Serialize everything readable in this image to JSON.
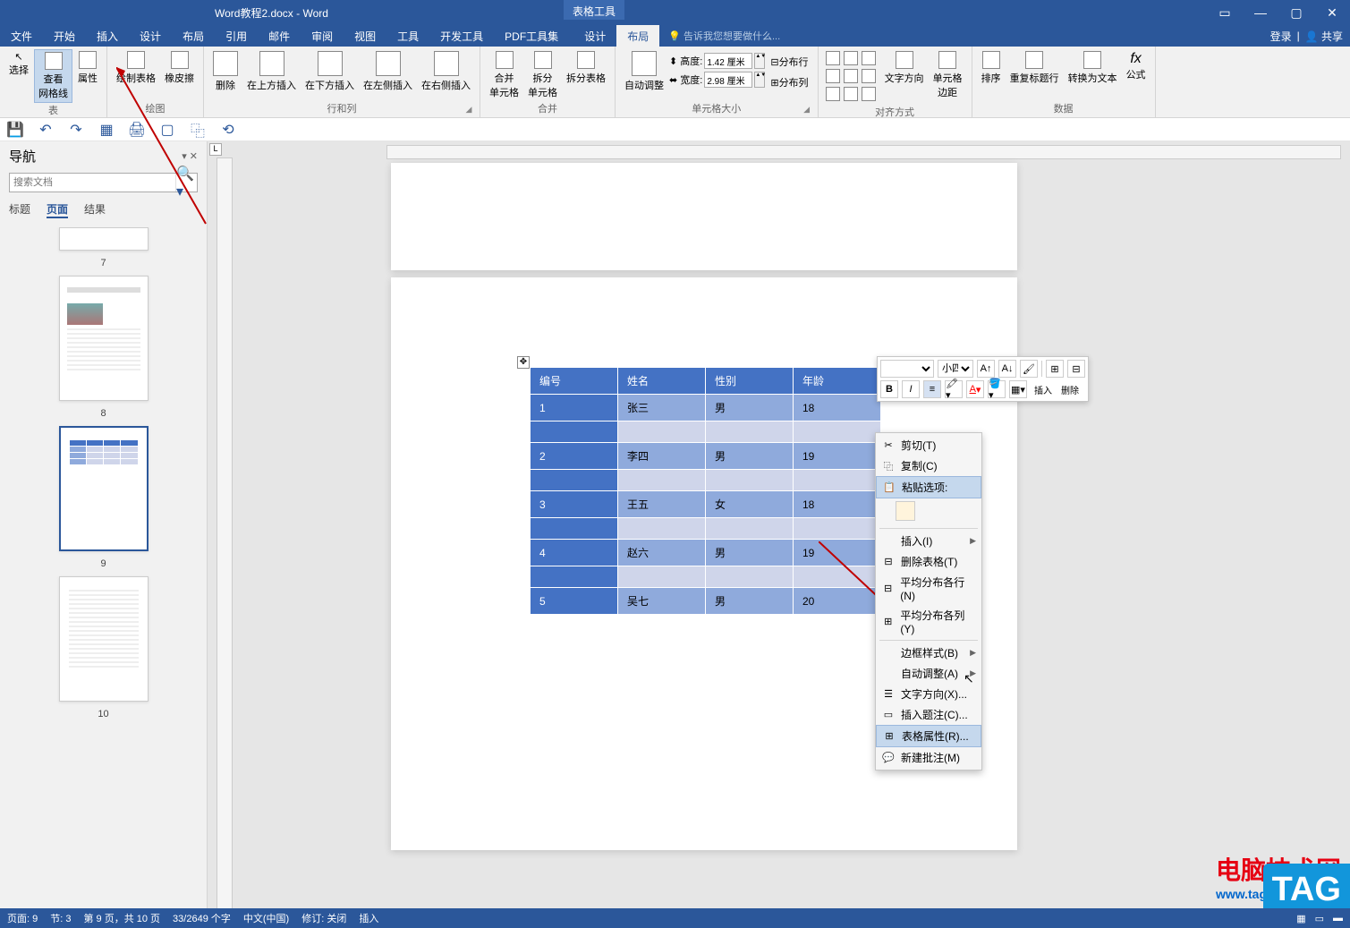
{
  "titlebar": {
    "filename": "Word教程2.docx - Word",
    "tabletools": "表格工具",
    "login": "登录",
    "share": "共享"
  },
  "menu": {
    "file": "文件",
    "home": "开始",
    "insert": "插入",
    "design": "设计",
    "layout": "布局",
    "references": "引用",
    "mailings": "邮件",
    "review": "审阅",
    "view": "视图",
    "tools": "工具",
    "developer": "开发工具",
    "pdftools": "PDF工具集",
    "tdesign": "设计",
    "tlayout": "布局",
    "tellme": "告诉我您想要做什么..."
  },
  "ribbon": {
    "select": "选择",
    "viewgrid": "查看\n网格线",
    "props": "属性",
    "g_table": "表",
    "draw": "绘制表格",
    "eraser": "橡皮擦",
    "g_draw": "绘图",
    "delete": "删除",
    "insabove": "在上方插入",
    "insbelow": "在下方插入",
    "insleft": "在左侧插入",
    "insright": "在右侧插入",
    "g_rowcol": "行和列",
    "merge": "合并\n单元格",
    "split": "拆分\n单元格",
    "splittbl": "拆分表格",
    "g_merge": "合并",
    "autofit": "自动调整",
    "height": "高度:",
    "hval": "1.42 厘米",
    "width": "宽度:",
    "wval": "2.98 厘米",
    "distrows": "分布行",
    "distcols": "分布列",
    "g_cellsize": "单元格大小",
    "textdir": "文字方向",
    "margins": "单元格\n边距",
    "g_align": "对齐方式",
    "sort": "排序",
    "rephdr": "重复标题行",
    "cvttext": "转换为文本",
    "formula": "公式",
    "g_data": "数据"
  },
  "nav": {
    "title": "导航",
    "search_ph": "搜索文档",
    "t1": "标题",
    "t2": "页面",
    "t3": "结果",
    "p7": "7",
    "p8": "8",
    "p9": "9",
    "p10": "10"
  },
  "table": {
    "headers": [
      "编号",
      "姓名",
      "性别",
      "年龄"
    ],
    "rows": [
      [
        "1",
        "张三",
        "男",
        "18"
      ],
      [
        "2",
        "李四",
        "男",
        "19"
      ],
      [
        "3",
        "王五",
        "女",
        "18"
      ],
      [
        "4",
        "赵六",
        "男",
        "19"
      ],
      [
        "5",
        "吴七",
        "男",
        "20"
      ]
    ]
  },
  "minibar": {
    "fontsize": "小四"
  },
  "ctx": {
    "cut": "剪切(T)",
    "copy": "复制(C)",
    "pasteopt": "粘贴选项:",
    "insert": "插入(I)",
    "deltbl": "删除表格(T)",
    "distrows": "平均分布各行(N)",
    "distcols": "平均分布各列(Y)",
    "border": "边框样式(B)",
    "autofit": "自动调整(A)",
    "textdir": "文字方向(X)...",
    "caption": "插入题注(C)...",
    "tblprops": "表格属性(R)...",
    "newcomment": "新建批注(M)"
  },
  "status": {
    "page": "页面: 9",
    "section": "节: 3",
    "pageof": "第 9 页，共 10 页",
    "words": "33/2649 个字",
    "lang": "中文(中国)",
    "track": "修订: 关闭",
    "insmode": "插入"
  },
  "watermark": {
    "l1": "电脑技术网",
    "l2": "www.tagxp.com",
    "tag": "TAG"
  }
}
